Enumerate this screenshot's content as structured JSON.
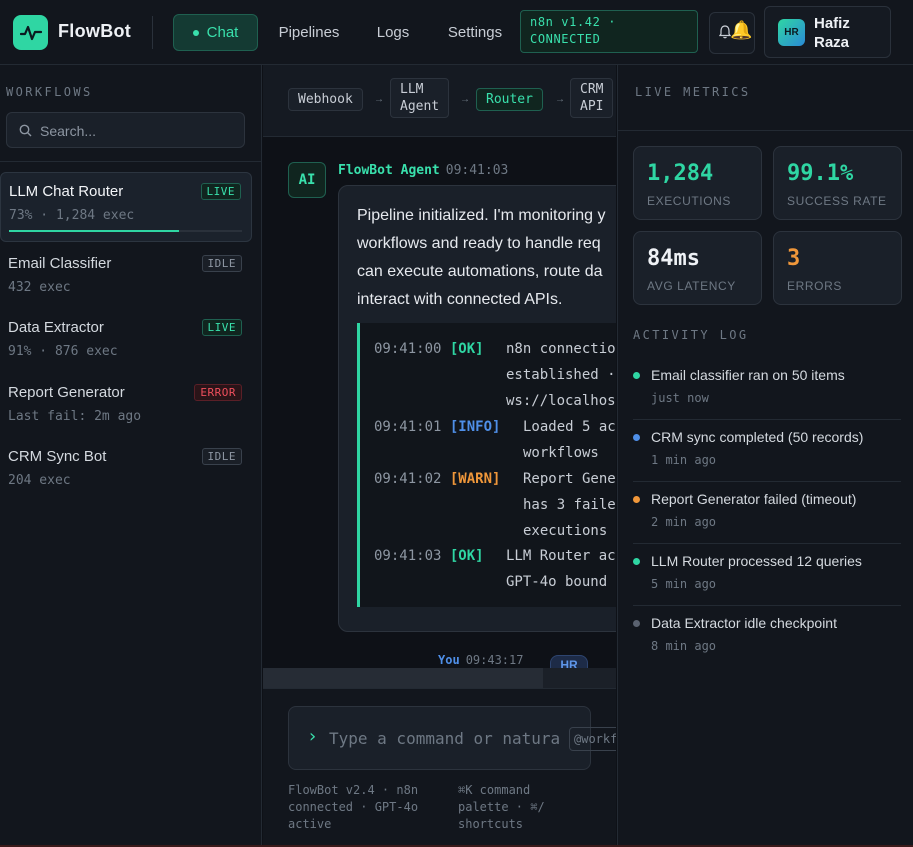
{
  "app": {
    "brand": "FlowBot",
    "nav": {
      "chat": "Chat",
      "pipelines": "Pipelines",
      "logs": "Logs",
      "settings": "Settings"
    },
    "status_line1": "n8n v1.42 ·",
    "status_line2": "CONNECTED",
    "bell_emoji": "🔔",
    "user": {
      "initials": "HR",
      "name": "Hafiz Raza"
    },
    "colors": {
      "accent": "#2fd6a3",
      "info": "#4f8fe8",
      "warn": "#f0973a",
      "error": "#ef4f5d"
    }
  },
  "sidebar": {
    "section_label": "WORKFLOWS",
    "search_placeholder": "Search...",
    "workflows": [
      {
        "title": "LLM Chat Router",
        "sub": "73% · 1,284 exec",
        "badge": "LIVE",
        "progress_percent": 73
      },
      {
        "title": "Email Classifier",
        "sub": "432 exec",
        "badge": "IDLE"
      },
      {
        "title": "Data Extractor",
        "sub": "91% · 876 exec",
        "badge": "LIVE"
      },
      {
        "title": "Report Generator",
        "sub": "Last fail: 2m ago",
        "badge": "ERROR"
      },
      {
        "title": "CRM Sync Bot",
        "sub": "204 exec",
        "badge": "IDLE"
      }
    ]
  },
  "pipeline": {
    "nodes": [
      {
        "line1": "Webhook",
        "line2": ""
      },
      {
        "line1": "LLM",
        "line2": "Agent"
      },
      {
        "line1": "Router",
        "line2": ""
      },
      {
        "line1": "CRM",
        "line2": "API"
      }
    ],
    "arrow": "→"
  },
  "chat": {
    "ai_avatar": "AI",
    "ai_name": "FlowBot Agent",
    "ai_time": "09:41:03",
    "lines": [
      "Pipeline initialized. I'm monitoring y",
      "workflows and ready to handle req",
      "can execute automations, route da",
      "interact with connected APIs."
    ],
    "logs": [
      {
        "time": "09:41:00",
        "tag": "[OK]",
        "msg1": "n8n connectio",
        "msg2": "established ·",
        "msg3": "ws://localhos"
      },
      {
        "time": "09:41:01",
        "tag": "[INFO]",
        "msg1": "Loaded 5 ac",
        "msg2": "workflows"
      },
      {
        "time": "09:41:02",
        "tag": "[WARN]",
        "msg1": "Report Gene",
        "msg2": "has 3 faile",
        "msg3": "executions"
      },
      {
        "time": "09:41:03",
        "tag": "[OK]",
        "msg1": "LLM Router ac",
        "msg2": "GPT-4o bound"
      }
    ],
    "you_name": "You",
    "you_time": "09:43:17",
    "you_avatar": "HR",
    "input_placeholder": "Type a command or natural",
    "prompt_glyph": "›",
    "mention": "@workflow",
    "footer_left": [
      "FlowBot v2.4 · n8n",
      "connected · GPT-4o",
      "active"
    ],
    "footer_right": [
      "⌘K command",
      "palette · ⌘/",
      "shortcuts"
    ]
  },
  "metrics_panel": {
    "section_label": "LIVE METRICS",
    "metrics": [
      {
        "value": "1,284",
        "label": "EXECUTIONS",
        "color": "#2fd6a3"
      },
      {
        "value": "99.1%",
        "label": "SUCCESS RATE",
        "color": "#2fd6a3"
      },
      {
        "value": "84ms",
        "label": "AVG LATENCY",
        "color": "#eef1f5"
      },
      {
        "value": "3",
        "label": "ERRORS",
        "color": "#f0973a"
      }
    ],
    "activity_label": "ACTIVITY LOG",
    "activity": [
      {
        "text": "Email classifier ran on 50 items",
        "time": "just now",
        "color": "#2fd6a3"
      },
      {
        "text": "CRM sync completed (50 records)",
        "time": "1 min ago",
        "color": "#4f8fe8"
      },
      {
        "text": "Report Generator failed (timeout)",
        "time": "2 min ago",
        "color": "#f0973a"
      },
      {
        "text": "LLM Router processed 12 queries",
        "time": "5 min ago",
        "color": "#2fd6a3"
      },
      {
        "text": "Data Extractor idle checkpoint",
        "time": "8 min ago",
        "color": "#5a6270"
      }
    ]
  }
}
